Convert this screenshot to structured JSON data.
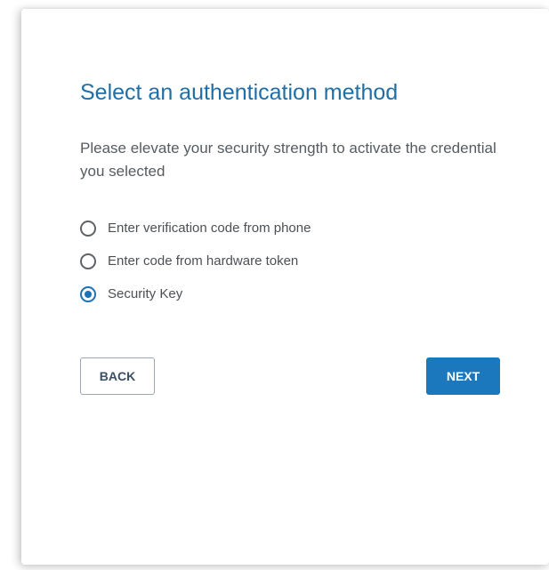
{
  "card": {
    "title": "Select an authentication method",
    "description": "Please elevate your security strength to activate the credential you selected"
  },
  "auth_methods": {
    "options": [
      {
        "label": "Enter verification code from phone",
        "selected": false
      },
      {
        "label": "Enter code from hardware token",
        "selected": false
      },
      {
        "label": "Security Key",
        "selected": true
      }
    ],
    "selected_value": "Security Key"
  },
  "buttons": {
    "back_label": "BACK",
    "next_label": "NEXT"
  },
  "colors": {
    "title": "#1f6fa6",
    "accent": "#1c78bd",
    "text": "#555b60"
  }
}
